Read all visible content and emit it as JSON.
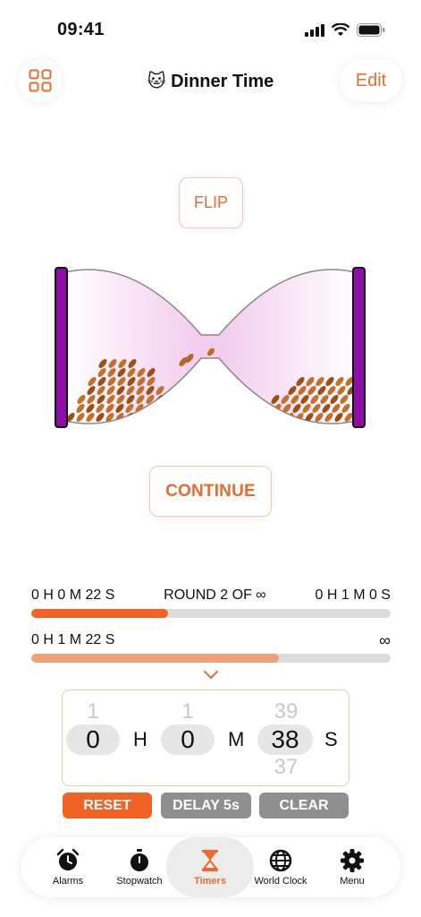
{
  "status_bar": {
    "time": "09:41"
  },
  "header": {
    "title": "🐱 Dinner Time",
    "edit_label": "Edit",
    "grid_icon": "grid-icon"
  },
  "flip_label": "FLIP",
  "continue_label": "CONTINUE",
  "round": {
    "elapsed": "0 H 0 M 22 S",
    "round_label": "ROUND 2 OF ∞",
    "duration": "0 H 1 M 0 S",
    "progress_fraction": 0.38
  },
  "total": {
    "elapsed": "0 H 1 M 22 S",
    "limit": "∞",
    "progress_fraction": 0.69
  },
  "picker": {
    "hours": {
      "above": "1",
      "value": "0",
      "unit": "H"
    },
    "minutes": {
      "above": "1",
      "value": "0",
      "unit": "M"
    },
    "seconds": {
      "above": "39",
      "value": "38",
      "below": "37",
      "unit": "S"
    }
  },
  "actions": {
    "reset": "RESET",
    "delay": "DELAY 5s",
    "clear": "CLEAR"
  },
  "colors": {
    "accent": "#ea6b2c",
    "accent_light": "#f0a07a",
    "frame": "#8e0ea8"
  },
  "tabs": [
    {
      "label": "Alarms",
      "icon": "alarm-clock-icon"
    },
    {
      "label": "Stopwatch",
      "icon": "stopwatch-icon"
    },
    {
      "label": "Timers",
      "icon": "hourglass-icon",
      "active": true
    },
    {
      "label": "World Clock",
      "icon": "globe-icon"
    },
    {
      "label": "Menu",
      "icon": "gear-icon"
    }
  ]
}
